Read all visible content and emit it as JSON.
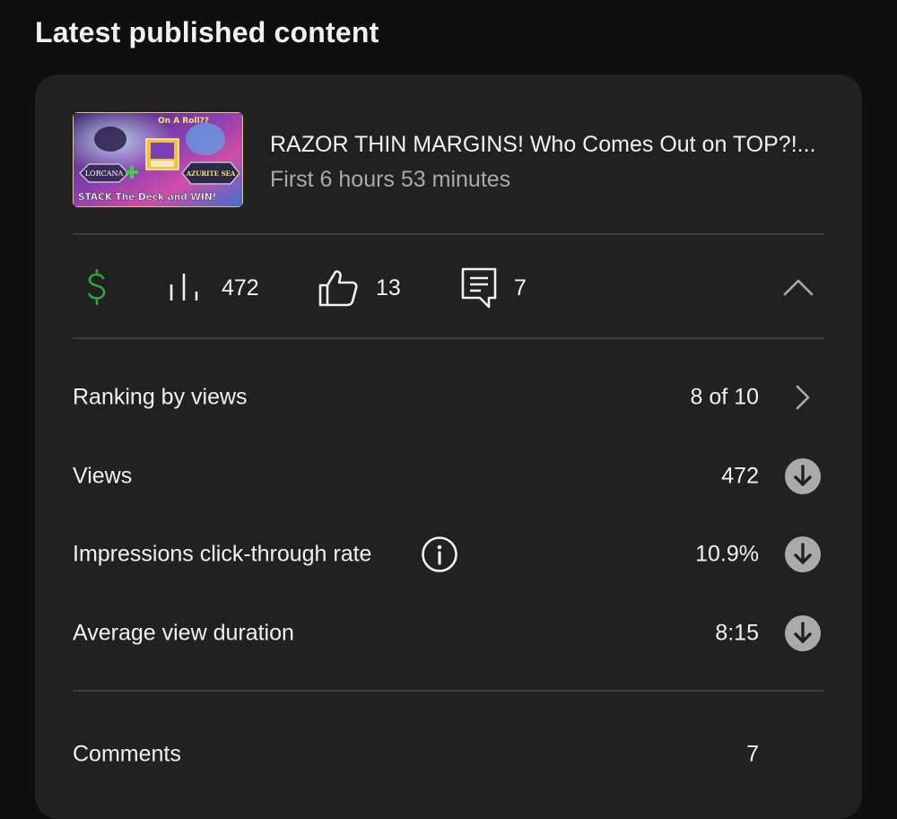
{
  "page": {
    "title": "Latest published content"
  },
  "video": {
    "title": "RAZOR THIN MARGINS! Who Comes Out on TOP?!...",
    "subtitle": "First 6 hours 53 minutes",
    "thumbnail": {
      "top_text": "On A Roll??",
      "left_logo": "LORCANA",
      "right_logo": "AZURITE SEA",
      "bottom_text": "STACK The Deck and WIN!"
    }
  },
  "stats": {
    "views": "472",
    "likes": "13",
    "comments": "7"
  },
  "metrics": {
    "ranking_label": "Ranking by views",
    "ranking_value": "8 of 10",
    "views_label": "Views",
    "views_value": "472",
    "ctr_label": "Impressions click-through rate",
    "ctr_value": "10.9%",
    "avd_label": "Average view duration",
    "avd_value": "8:15",
    "comments_label": "Comments",
    "comments_value": "7"
  },
  "colors": {
    "background": "#0f0f0f",
    "card": "#212121",
    "monetization_green": "#2ba640",
    "trend_icon_bg": "#aaaaaa"
  },
  "icons": {
    "monetization": "dollar-icon",
    "views": "bar-chart-icon",
    "likes": "thumbs-up-icon",
    "comments": "comment-icon",
    "collapse": "chevron-up-icon",
    "ranking": "chevron-right-icon",
    "trend": "arrow-down-circle-icon",
    "info": "info-icon"
  }
}
